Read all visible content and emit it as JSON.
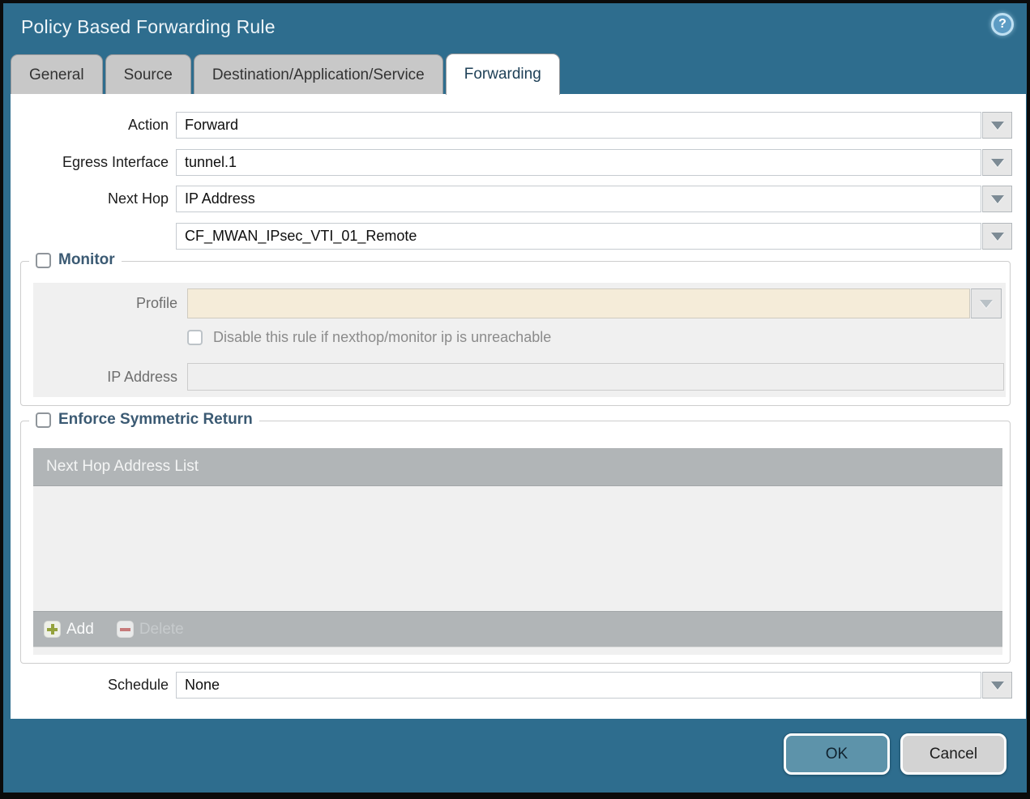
{
  "window": {
    "title": "Policy Based Forwarding Rule",
    "help_glyph": "?"
  },
  "tabs": [
    {
      "label": "General",
      "active": false
    },
    {
      "label": "Source",
      "active": false
    },
    {
      "label": "Destination/Application/Service",
      "active": false
    },
    {
      "label": "Forwarding",
      "active": true
    }
  ],
  "form": {
    "action": {
      "label": "Action",
      "value": "Forward"
    },
    "egress_interface": {
      "label": "Egress Interface",
      "value": "tunnel.1"
    },
    "next_hop": {
      "label": "Next Hop",
      "value": "IP Address"
    },
    "next_hop_address": {
      "value": "CF_MWAN_IPsec_VTI_01_Remote"
    },
    "schedule": {
      "label": "Schedule",
      "value": "None"
    }
  },
  "monitor": {
    "title": "Monitor",
    "checked": false,
    "profile": {
      "label": "Profile",
      "value": ""
    },
    "disable_rule": {
      "label": "Disable this rule if nexthop/monitor ip is unreachable",
      "checked": false
    },
    "ip_address": {
      "label": "IP Address",
      "value": ""
    }
  },
  "enforce_symmetric_return": {
    "title": "Enforce Symmetric Return",
    "checked": false,
    "table": {
      "header": "Next Hop Address List",
      "rows": []
    },
    "add_label": "Add",
    "delete_label": "Delete"
  },
  "footer": {
    "ok_label": "OK",
    "cancel_label": "Cancel"
  },
  "colors": {
    "titlebar_teal": "#2e6d8e",
    "ok_button_teal": "#5d93aa",
    "section_title": "#3b5a73",
    "profile_field_tan": "#f5ecd9",
    "table_bar_gray": "#b1b5b7",
    "panel_gray": "#f0f0f0",
    "add_plus_green": "#94a23c",
    "delete_minus_red": "#c77a7a"
  }
}
